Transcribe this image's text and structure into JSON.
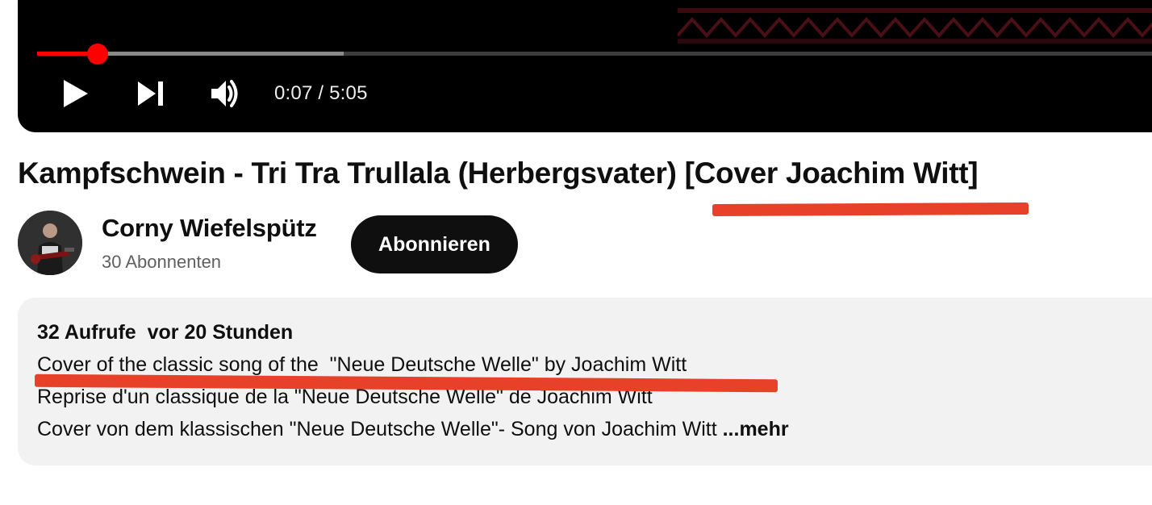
{
  "player": {
    "time_display": "0:07 / 5:05",
    "progress_fraction": 0.053,
    "buffered_fraction": 0.27,
    "accent_color": "#ff0000",
    "icons": [
      "play-icon",
      "next-icon",
      "volume-icon"
    ]
  },
  "video": {
    "title": "Kampfschwein - Tri Tra Trullala (Herbergsvater) [Cover Joachim Witt]"
  },
  "channel": {
    "name": "Corny Wiefelspütz",
    "subscribers": "30 Abonnenten",
    "subscribe_label": "Abonnieren"
  },
  "description": {
    "meta": "32 Aufrufe  vor 20 Stunden",
    "lines": [
      "Cover of the classic song of the  \"Neue Deutsche Welle\" by Joachim Witt",
      "Reprise d'un classique de la \"Neue Deutsche Welle\" de Joachim Witt",
      "Cover von dem klassischen \"Neue Deutsche Welle\"- Song von Joachim Witt "
    ],
    "more_label": "...mehr"
  },
  "annotation_color": "#e8412a"
}
